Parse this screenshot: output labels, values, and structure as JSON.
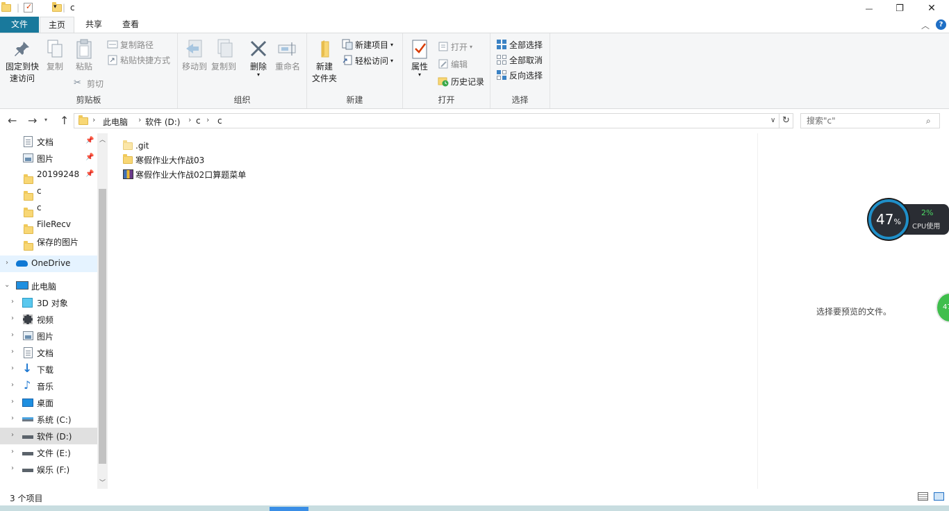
{
  "titlebar": {
    "title": "c",
    "controls": {
      "minimize": "—",
      "maximize": "❐",
      "close": "✕"
    }
  },
  "ribbon_tabs": {
    "file": "文件",
    "home": "主页",
    "share": "共享",
    "view": "查看"
  },
  "ribbon": {
    "clipboard": {
      "label": "剪贴板",
      "pin_line1": "固定到快",
      "pin_line2": "速访问",
      "copy": "复制",
      "paste": "粘贴",
      "copy_path": "复制路径",
      "paste_shortcut": "粘贴快捷方式",
      "cut": "剪切"
    },
    "organize": {
      "label": "组织",
      "move_to": "移动到",
      "copy_to": "复制到",
      "delete": "删除",
      "rename": "重命名"
    },
    "new": {
      "label": "新建",
      "new_folder_line1": "新建",
      "new_folder_line2": "文件夹",
      "new_item": "新建项目",
      "easy_access": "轻松访问"
    },
    "open": {
      "label": "打开",
      "properties": "属性",
      "open": "打开",
      "edit": "编辑",
      "history": "历史记录"
    },
    "select": {
      "label": "选择",
      "select_all": "全部选择",
      "select_none": "全部取消",
      "invert": "反向选择"
    }
  },
  "address": {
    "crumbs": [
      "此电脑",
      "软件 (D:)",
      "c",
      "c"
    ],
    "search_placeholder": "搜索\"c\""
  },
  "nav": {
    "quick_access": [
      {
        "label": "文档",
        "pinned": true
      },
      {
        "label": "图片",
        "pinned": true
      },
      {
        "label": "20199248",
        "pinned": true
      },
      {
        "label": "c",
        "pinned": false
      },
      {
        "label": "c",
        "pinned": false
      },
      {
        "label": "FileRecv",
        "pinned": false
      },
      {
        "label": "保存的图片",
        "pinned": false
      }
    ],
    "onedrive": "OneDrive",
    "this_pc": "此电脑",
    "pc_items": [
      {
        "label": "3D 对象",
        "icon": "cube-icon"
      },
      {
        "label": "视频",
        "icon": "film-icon"
      },
      {
        "label": "图片",
        "icon": "picture-icon"
      },
      {
        "label": "文档",
        "icon": "document-icon"
      },
      {
        "label": "下载",
        "icon": "download-icon"
      },
      {
        "label": "音乐",
        "icon": "music-icon"
      },
      {
        "label": "桌面",
        "icon": "desktop-icon"
      },
      {
        "label": "系统 (C:)",
        "icon": "drive-icon"
      },
      {
        "label": "软件 (D:)",
        "icon": "drive-icon"
      },
      {
        "label": "文件 (E:)",
        "icon": "drive-icon"
      },
      {
        "label": "娱乐 (F:)",
        "icon": "drive-icon"
      }
    ]
  },
  "files": [
    {
      "name": ".git",
      "type": "folder-hidden"
    },
    {
      "name": "寒假作业大作战03",
      "type": "folder"
    },
    {
      "name": "寒假作业大作战02口算题菜单",
      "type": "archive"
    }
  ],
  "preview": {
    "empty_text": "选择要预览的文件。"
  },
  "status": {
    "item_count": "3 个项目"
  },
  "cpu_widget": {
    "percent": "47",
    "percent_sign": "%",
    "cpu_usage": "2%",
    "cpu_label": "CPU使用",
    "badge": "47"
  }
}
